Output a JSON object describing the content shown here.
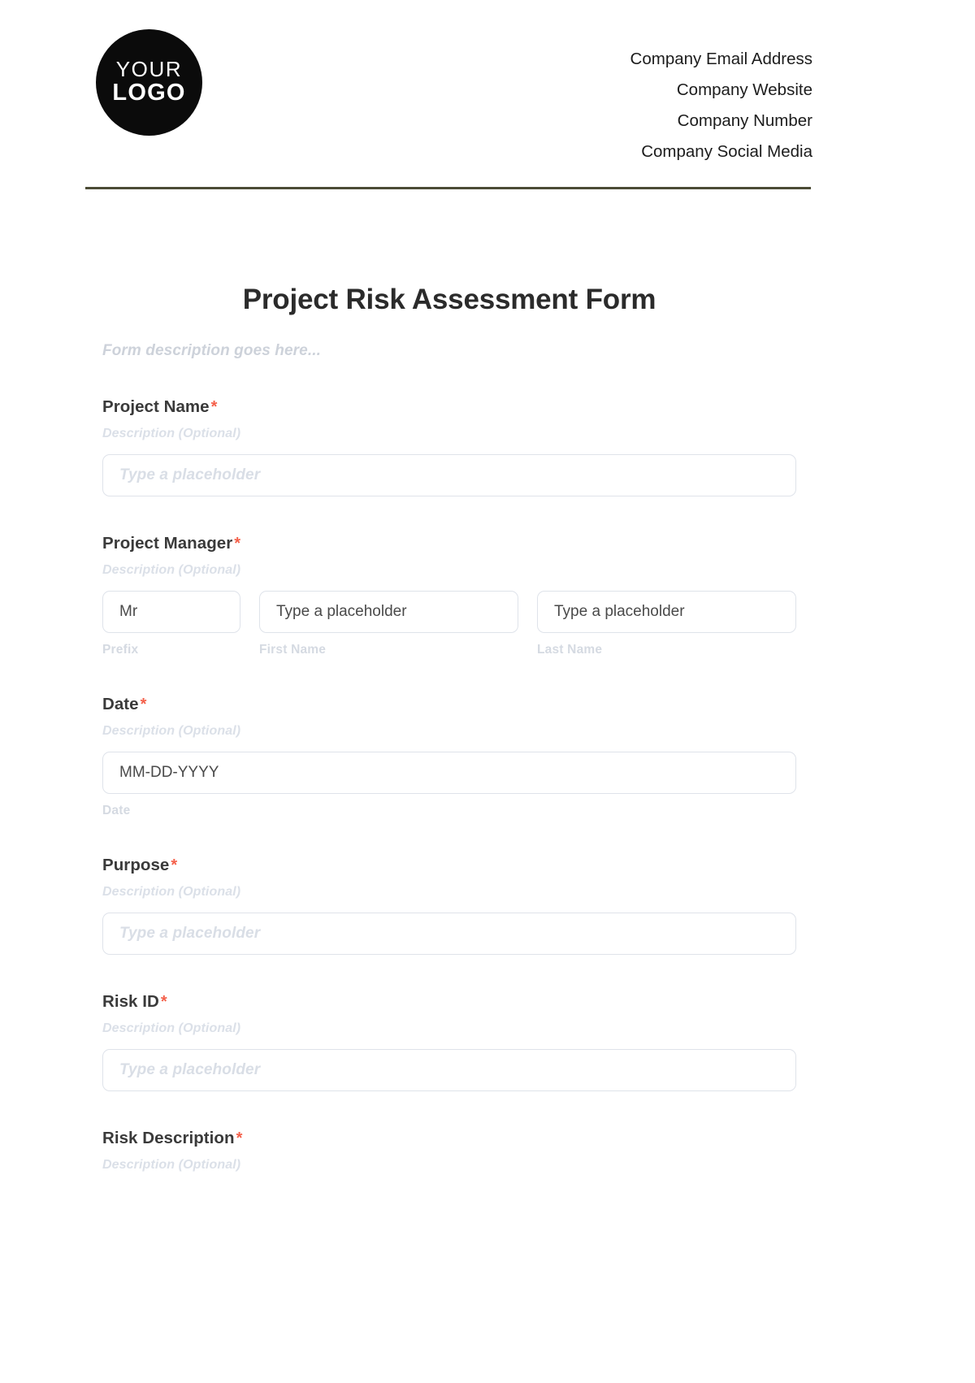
{
  "header": {
    "logo": {
      "line1": "YOUR",
      "line2": "LOGO"
    },
    "company_lines": [
      "Company Email Address",
      "Company Website",
      "Company Number",
      "Company Social Media"
    ],
    "rule_color": "#4b4b35"
  },
  "form": {
    "title": "Project Risk Assessment Form",
    "description": "Form description goes here...",
    "required_marker": "*",
    "hint_text": "Description (Optional)",
    "placeholder": "Type a placeholder",
    "fields": [
      {
        "label": "Project Name",
        "hint": "Description (Optional)",
        "placeholder": "Type a placeholder"
      },
      {
        "label": "Project Manager",
        "hint": "Description (Optional)",
        "parts": [
          {
            "value": "Mr",
            "sub_label": "Prefix"
          },
          {
            "value": "Type a placeholder",
            "sub_label": "First Name"
          },
          {
            "value": "Type a placeholder",
            "sub_label": "Last Name"
          }
        ]
      },
      {
        "label": "Date",
        "hint": "Description (Optional)",
        "value": "MM-DD-YYYY",
        "sub_label": "Date"
      },
      {
        "label": "Purpose",
        "hint": "Description (Optional)",
        "placeholder": "Type a placeholder"
      },
      {
        "label": "Risk ID",
        "hint": "Description (Optional)",
        "placeholder": "Type a placeholder"
      },
      {
        "label": "Risk Description",
        "hint": "Description (Optional)"
      }
    ]
  }
}
